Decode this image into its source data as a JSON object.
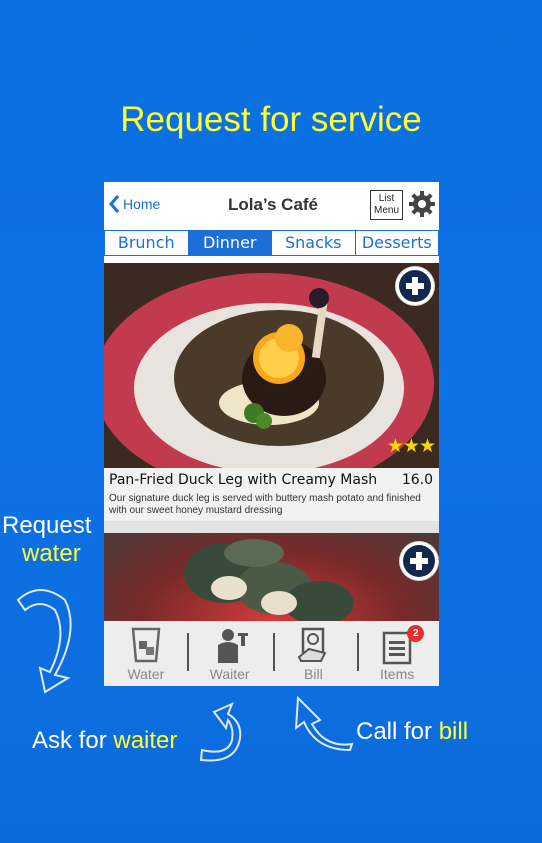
{
  "headline": "Request for service",
  "topbar": {
    "back_label": "Home",
    "title": "Lola’s Café",
    "list_menu_label": "List Menu"
  },
  "tabs": [
    {
      "label": "Brunch",
      "active": false
    },
    {
      "label": "Dinner",
      "active": true
    },
    {
      "label": "Snacks",
      "active": false
    },
    {
      "label": "Desserts",
      "active": false
    }
  ],
  "dish": {
    "name": "Pan-Fried Duck Leg with Creamy Mash",
    "price": "16.0",
    "description": "Our signature duck leg is served with buttery mash potato and finished with our sweet honey mustard dressing",
    "rating_stars": "★★★"
  },
  "bottom_bar": [
    {
      "label": "Water",
      "icon": "water-glass-icon"
    },
    {
      "label": "Waiter",
      "icon": "waiter-icon"
    },
    {
      "label": "Bill",
      "icon": "bill-icon"
    },
    {
      "label": "Items",
      "icon": "items-icon",
      "badge": "2"
    }
  ],
  "annotations": {
    "request_water_line1": "Request",
    "request_water_line2": "water",
    "ask_waiter_prefix": "Ask for ",
    "ask_waiter_highlight": "waiter",
    "call_bill_prefix": "Call for ",
    "call_bill_highlight": "bill"
  },
  "colors": {
    "background": "#0b6fe0",
    "accent_blue": "#1c6fd6",
    "highlight_yellow": "#ffff33",
    "badge_red": "#e53030",
    "star_yellow": "#f5d800"
  }
}
